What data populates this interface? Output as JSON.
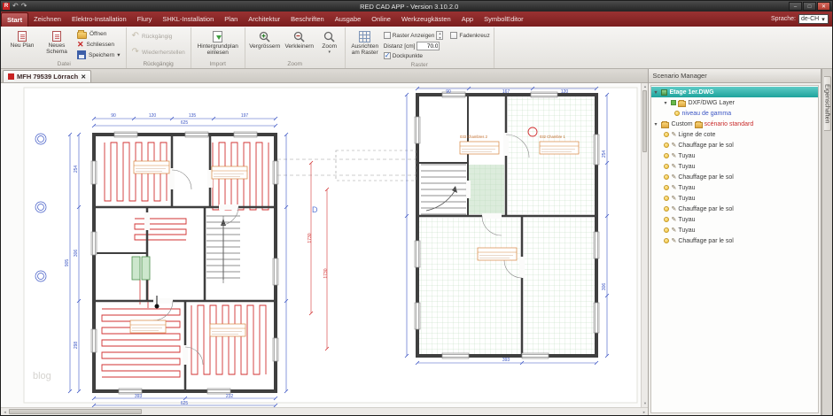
{
  "window": {
    "title": "RED CAD APP - Version 3.10.2.0",
    "logo_letter": "R",
    "controls": {
      "minimize": "–",
      "maximize": "□",
      "close": "✕"
    }
  },
  "icons": {
    "caret": "▾",
    "arrow_down": "▾",
    "arrow_right": "▸",
    "pencil": "✎",
    "undo": "↶",
    "redo": "↷",
    "up": "▲",
    "down": "▼",
    "left": "◄",
    "right": "►"
  },
  "menubar": {
    "tabs": [
      "Start",
      "Zeichnen",
      "Elektro-Installation",
      "Flury",
      "SHKL-Installation",
      "Plan",
      "Architektur",
      "Beschriften",
      "Ausgabe",
      "Online",
      "Werkzeugkästen",
      "App",
      "SymbolEditor"
    ],
    "active_tab": "Start",
    "language_label": "Sprache:",
    "language_value": "de-CH"
  },
  "ribbon": {
    "datei": {
      "label": "Datei",
      "new_plan": "Neu Plan",
      "new_schema": "Neues Schema",
      "open": "Öffnen",
      "close": "Schliessen",
      "save": "Speichern"
    },
    "rueckgaengig": {
      "label": "Rückgängig",
      "undo": "Rückgängig",
      "redo": "Wiederherstellen"
    },
    "import": {
      "label": "Import",
      "background_plan": "Hintergrundplan einlesen"
    },
    "zoom": {
      "label": "Zoom",
      "zoom_in": "Vergrössern",
      "zoom_out": "Verkleinern",
      "zoom": "Zoom"
    },
    "raster": {
      "label": "Raster",
      "align": "Ausrichten am Raster",
      "show_raster": "Raster Anzeigen",
      "crosshair": "Fadenkreuz",
      "distance_label": "Distanz [cm]",
      "distance_value": "70.0",
      "dock_points": "Dockpunkte"
    }
  },
  "document": {
    "tab_title": "MFH 79539 Lörrach",
    "close_glyph": "✕"
  },
  "canvas": {
    "axis_label_d": "D",
    "watermark": "blog",
    "room_labels": [
      "033 Chambres 2",
      "032 Chambre 1"
    ],
    "dims": [
      "90",
      "120",
      "135",
      "197",
      "625",
      "254",
      "306",
      "298",
      "905",
      "393",
      "232",
      "625",
      "90",
      "167",
      "120",
      "254",
      "306",
      "393",
      "1730",
      "1730"
    ]
  },
  "scenario": {
    "title": "Scenario Manager",
    "root": "Etage 1er.DWG",
    "layer": "DXF/DWG Layer",
    "level": "niveau de gamma",
    "custom_label": "Custom",
    "scenario_name": "scénario standard",
    "items": [
      "Ligne de cote",
      "Chauffage par le sol",
      "Tuyau",
      "Tuyau",
      "Chauffage par le sol",
      "Tuyau",
      "Tuyau",
      "Chauffage par le sol",
      "Tuyau",
      "Tuyau",
      "Chauffage par le sol"
    ]
  },
  "properties_tab": "Eigenschaften"
}
